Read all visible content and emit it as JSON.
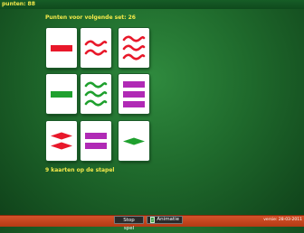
{
  "header": {
    "score_text": "punten: 88"
  },
  "game": {
    "next_set_text": "Punten voor volgende set: 26",
    "stack_text": "9 kaarten op de stapel"
  },
  "cards": [
    {
      "shape": "rectangle",
      "color": "#e8182a",
      "count": 1,
      "fill": "solid"
    },
    {
      "shape": "squiggle",
      "color": "#e8182a",
      "count": 2,
      "fill": "solid"
    },
    {
      "shape": "squiggle",
      "color": "#e8182a",
      "count": 3,
      "fill": "solid"
    },
    {
      "shape": "rectangle",
      "color": "#1fa02e",
      "count": 1,
      "fill": "solid"
    },
    {
      "shape": "squiggle",
      "color": "#1fa02e",
      "count": 3,
      "fill": "solid"
    },
    {
      "shape": "rectangle",
      "color": "#b02ab5",
      "count": 3,
      "fill": "solid"
    },
    {
      "shape": "diamond",
      "color": "#e8182a",
      "count": 2,
      "fill": "solid"
    },
    {
      "shape": "rectangle",
      "color": "#b02ab5",
      "count": 2,
      "fill": "solid"
    },
    {
      "shape": "diamond",
      "color": "#1fa02e",
      "count": 1,
      "fill": "solid"
    }
  ],
  "footer": {
    "stop_label": "Stop spel",
    "animate_label": "Animatie",
    "animate_checked": true,
    "version_text": "versie: 28-03-2011"
  }
}
